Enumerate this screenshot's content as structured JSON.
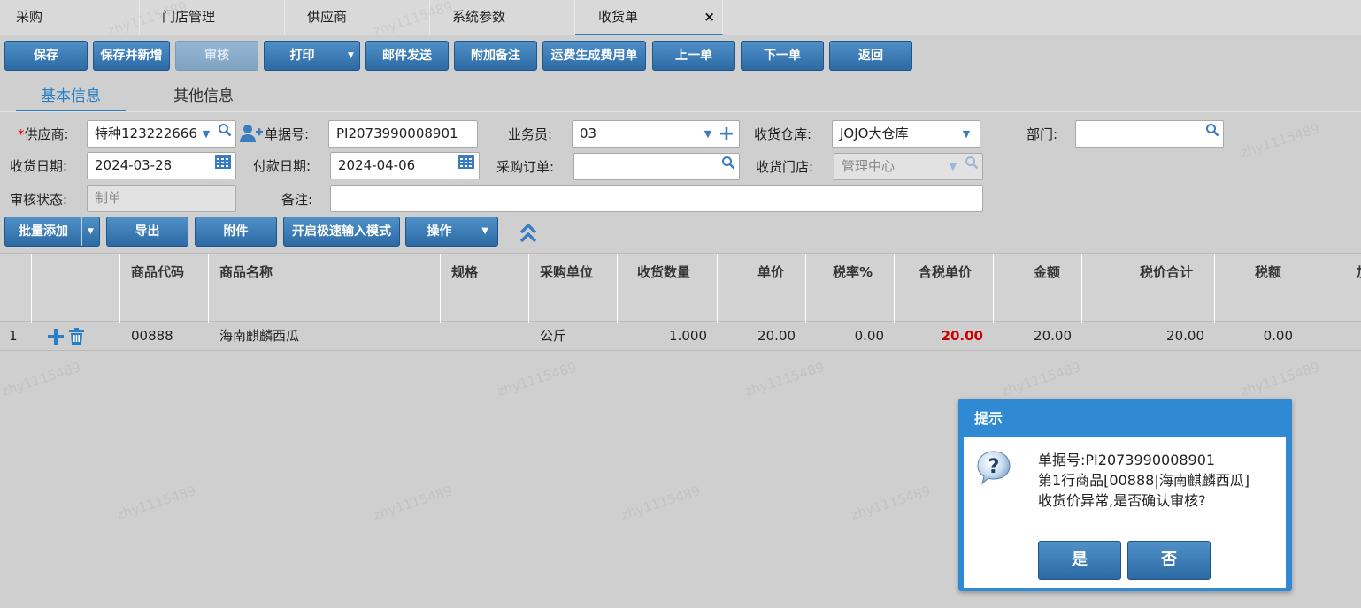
{
  "tabs": [
    {
      "label": "采购"
    },
    {
      "label": "门店管理"
    },
    {
      "label": "供应商"
    },
    {
      "label": "系统参数"
    },
    {
      "label": "收货单",
      "active": true
    }
  ],
  "tab_close": "×",
  "toolbar": {
    "save": "保存",
    "save_new": "保存并新增",
    "audit": "审核",
    "print": "打印",
    "email": "邮件发送",
    "remark": "附加备注",
    "freight": "运费生成费用单",
    "prev": "上一单",
    "next": "下一单",
    "back": "返回"
  },
  "subtabs": {
    "basic": "基本信息",
    "other": "其他信息"
  },
  "form": {
    "supplier_label": "供应商:",
    "supplier_req": "*",
    "supplier_value": "特种123222666",
    "docno_label": "单据号:",
    "docno_value": "PI2073990008901",
    "salesman_label": "业务员:",
    "salesman_value": "03",
    "warehouse_label": "收货仓库:",
    "warehouse_value": "JOJO大仓库",
    "dept_label": "部门:",
    "dept_value": "",
    "recvdate_label": "收货日期:",
    "recvdate_value": "2024-03-28",
    "paydate_label": "付款日期:",
    "paydate_value": "2024-04-06",
    "po_label": "采购订单:",
    "po_value": "",
    "store_label": "收货门店:",
    "store_value": "管理中心",
    "status_label": "审核状态:",
    "status_value": "制单",
    "note_label": "备注:",
    "note_value": ""
  },
  "actions": {
    "batch_add": "批量添加",
    "export": "导出",
    "attach": "附件",
    "fast_mode": "开启极速输入模式",
    "ops": "操作"
  },
  "grid": {
    "headers": {
      "code": "商品代码",
      "name": "商品名称",
      "spec": "规格",
      "unit": "采购单位",
      "qty": "收货数量",
      "price": "单价",
      "tax_rate": "税率%",
      "tax_price": "含税单价",
      "amount": "金额",
      "total": "税价合计",
      "tax": "税额",
      "more": "加"
    },
    "rows": [
      {
        "no": "1",
        "code": "00888",
        "name": "海南麒麟西瓜",
        "spec": "",
        "unit": "公斤",
        "qty": "1.000",
        "price": "20.00",
        "tax_rate": "0.00",
        "tax_price": "20.00",
        "amount": "20.00",
        "total": "20.00",
        "tax": "0.00"
      }
    ]
  },
  "watermark": "zhy1115489",
  "dialog": {
    "title": "提示",
    "line1": "单据号:PI2073990008901",
    "line2": "第1行商品[00888|海南麒麟西瓜]",
    "line3": "收货价异常,是否确认审核?",
    "yes": "是",
    "no": "否"
  },
  "colors": {
    "accent": "#2a7fc4",
    "button": "#3a7cb8",
    "dialog": "#2f8ad3",
    "alert_red": "#cc0000"
  },
  "icons": [
    "close-icon",
    "caret-down-icon",
    "search-icon",
    "add-user-icon",
    "plus-icon",
    "calendar-icon",
    "trash-icon",
    "double-chevron-up-icon",
    "question-icon"
  ]
}
